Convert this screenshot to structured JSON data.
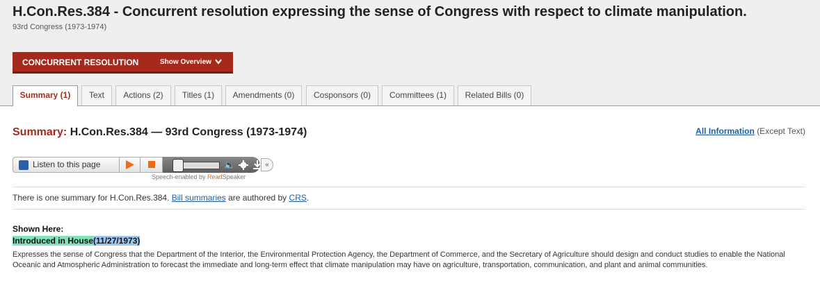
{
  "header": {
    "title": "H.Con.Res.384 - Concurrent resolution expressing the sense of Congress with respect to climate manipulation.",
    "congress": "93rd Congress (1973-1974)"
  },
  "typebar": {
    "label": "CONCURRENT RESOLUTION",
    "overview": "Show Overview"
  },
  "tabs": [
    {
      "label": "Summary (1)",
      "active": true
    },
    {
      "label": "Text"
    },
    {
      "label": "Actions (2)"
    },
    {
      "label": "Titles (1)"
    },
    {
      "label": "Amendments (0)"
    },
    {
      "label": "Cosponsors (0)"
    },
    {
      "label": "Committees (1)"
    },
    {
      "label": "Related Bills (0)"
    }
  ],
  "summary": {
    "heading_label": "Summary:",
    "heading_text": "H.Con.Res.384 — 93rd Congress (1973-1974)",
    "all_info_link": "All Information",
    "all_info_note": "(Except Text)"
  },
  "player": {
    "listen_label": "Listen to this page",
    "powered_prefix": "Speech-enabled by",
    "powered_read": "Read",
    "powered_speaker": "Speaker"
  },
  "info": {
    "prefix": "There is one summary for H.Con.Res.384.",
    "bill_summaries_link": "Bill summaries",
    "middle": "are authored by",
    "crs_link": "CRS",
    "suffix": "."
  },
  "shown_here": {
    "label": "Shown Here:",
    "introduced": "Introduced in House",
    "date": "(11/27/1973)",
    "description": "Expresses the sense of Congress that the Department of the Interior, the Environmental Protection Agency, the Department of Commerce, and the Secretary of Agriculture should design and conduct studies to enable the National Oceanic and Atmospheric Administration to forecast the immediate and long-term effect that climate manipulation may have on agriculture, transportation, communication, and plant and animal communities."
  },
  "colors": {
    "accent_red": "#a52a1c",
    "link_blue": "#1f5fa7",
    "play_orange": "#f06a14"
  }
}
